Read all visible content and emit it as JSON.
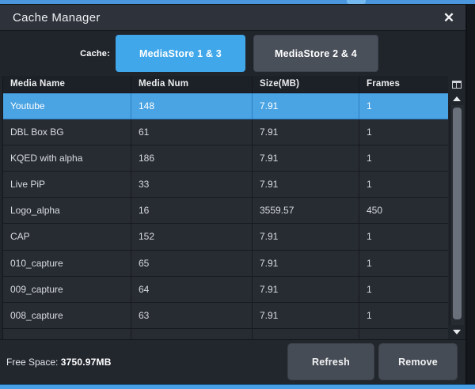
{
  "window": {
    "title": "Cache Manager",
    "close_glyph": "✕"
  },
  "cache_selector": {
    "label": "Cache:",
    "tabs": [
      {
        "label": "MediaStore 1 & 3",
        "selected": true
      },
      {
        "label": "MediaStore 2 & 4",
        "selected": false
      }
    ]
  },
  "table": {
    "columns": [
      "Media Name",
      "Media Num",
      "Size(MB)",
      "Frames"
    ],
    "rows": [
      {
        "name": "Youtube",
        "num": "148",
        "size": "7.91",
        "frames": "1",
        "selected": true
      },
      {
        "name": "DBL Box BG",
        "num": "61",
        "size": "7.91",
        "frames": "1"
      },
      {
        "name": "KQED with alpha",
        "num": "186",
        "size": "7.91",
        "frames": "1"
      },
      {
        "name": "Live PiP",
        "num": "33",
        "size": "7.91",
        "frames": "1"
      },
      {
        "name": "Logo_alpha",
        "num": "16",
        "size": "3559.57",
        "frames": "450"
      },
      {
        "name": "CAP",
        "num": "152",
        "size": "7.91",
        "frames": "1"
      },
      {
        "name": "010_capture",
        "num": "65",
        "size": "7.91",
        "frames": "1"
      },
      {
        "name": "009_capture",
        "num": "64",
        "size": "7.91",
        "frames": "1"
      },
      {
        "name": "008_capture",
        "num": "63",
        "size": "7.91",
        "frames": "1"
      }
    ]
  },
  "footer": {
    "free_space_label": "Free Space:",
    "free_space_value": "3750.97MB",
    "refresh_label": "Refresh",
    "remove_label": "Remove"
  },
  "colors": {
    "accent_blue": "#40a7ea",
    "selected_row_blue": "#4aa3e3",
    "button_gray": "#464c55",
    "dialog_bg": "#20252c",
    "titlebar_bg": "#2d323b"
  }
}
